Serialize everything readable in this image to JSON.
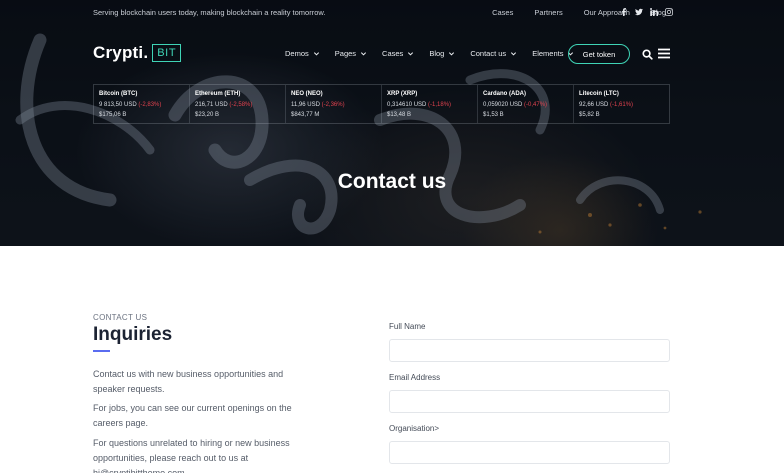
{
  "topbar": {
    "tagline": "Serving blockchain users today, making blockchain a reality tomorrow.",
    "links": [
      "Cases",
      "Partners",
      "Our Approach",
      "Blog"
    ],
    "socials": [
      "facebook-icon",
      "twitter-icon",
      "linkedin-icon",
      "instagram-icon"
    ]
  },
  "header": {
    "logo_text": "Crypti.",
    "logo_box": "BIT",
    "nav": [
      {
        "label": "Demos"
      },
      {
        "label": "Pages"
      },
      {
        "label": "Cases"
      },
      {
        "label": "Blog"
      },
      {
        "label": "Contact us"
      },
      {
        "label": "Elements"
      }
    ],
    "cta_label": "Get token",
    "accent_color": "#3fd4b6"
  },
  "ticker": [
    {
      "name": "Bitcoin (BTC)",
      "price": "9 813,50 USD",
      "change": "(-2,83%)",
      "cap": "$175,06 B"
    },
    {
      "name": "Ethereum (ETH)",
      "price": "216,71 USD",
      "change": "(-2,58%)",
      "cap": "$23,20 B"
    },
    {
      "name": "NEO (NEO)",
      "price": "11,96 USD",
      "change": "(-2,36%)",
      "cap": "$843,77 M"
    },
    {
      "name": "XRP (XRP)",
      "price": "0,314610 USD",
      "change": "(-1,18%)",
      "cap": "$13,48 B"
    },
    {
      "name": "Cardano (ADA)",
      "price": "0,059020 USD",
      "change": "(-0,47%)",
      "cap": "$1,53 B"
    },
    {
      "name": "Litecoin (LTC)",
      "price": "92,66 USD",
      "change": "(-1,61%)",
      "cap": "$5,82 B"
    }
  ],
  "hero": {
    "title": "Contact us"
  },
  "inquiries": {
    "eyebrow": "Contact us",
    "heading": "Inquiries",
    "paragraph_1": "Contact us with new business opportunities and speaker requests.",
    "paragraph_2": "For jobs, you can see our current openings on the careers page.",
    "paragraph_3": "For questions unrelated to hiring or new business opportunities, please reach out to us at hi@cryptibittheme.com"
  },
  "form": {
    "full_name_label": "Full Name",
    "email_label": "Email Address",
    "organisation_label": "Organisation>"
  }
}
